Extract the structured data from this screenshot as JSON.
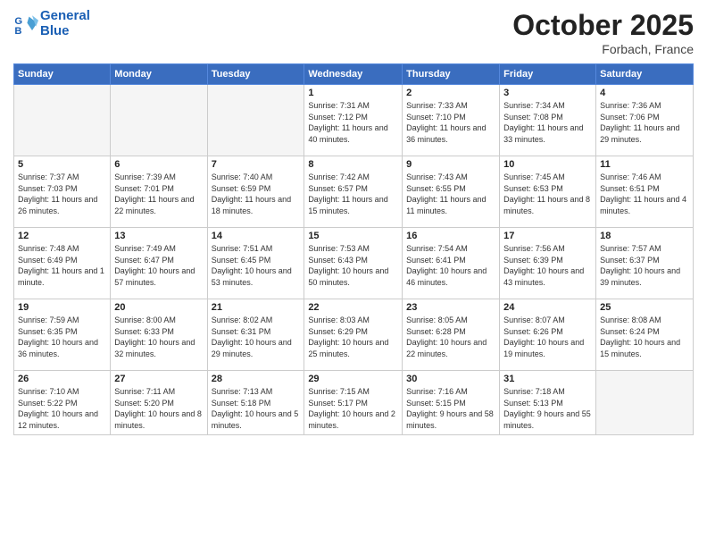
{
  "header": {
    "logo_line1": "General",
    "logo_line2": "Blue",
    "month": "October 2025",
    "location": "Forbach, France"
  },
  "weekdays": [
    "Sunday",
    "Monday",
    "Tuesday",
    "Wednesday",
    "Thursday",
    "Friday",
    "Saturday"
  ],
  "weeks": [
    [
      {
        "day": "",
        "info": ""
      },
      {
        "day": "",
        "info": ""
      },
      {
        "day": "",
        "info": ""
      },
      {
        "day": "1",
        "info": "Sunrise: 7:31 AM\nSunset: 7:12 PM\nDaylight: 11 hours\nand 40 minutes."
      },
      {
        "day": "2",
        "info": "Sunrise: 7:33 AM\nSunset: 7:10 PM\nDaylight: 11 hours\nand 36 minutes."
      },
      {
        "day": "3",
        "info": "Sunrise: 7:34 AM\nSunset: 7:08 PM\nDaylight: 11 hours\nand 33 minutes."
      },
      {
        "day": "4",
        "info": "Sunrise: 7:36 AM\nSunset: 7:06 PM\nDaylight: 11 hours\nand 29 minutes."
      }
    ],
    [
      {
        "day": "5",
        "info": "Sunrise: 7:37 AM\nSunset: 7:03 PM\nDaylight: 11 hours\nand 26 minutes."
      },
      {
        "day": "6",
        "info": "Sunrise: 7:39 AM\nSunset: 7:01 PM\nDaylight: 11 hours\nand 22 minutes."
      },
      {
        "day": "7",
        "info": "Sunrise: 7:40 AM\nSunset: 6:59 PM\nDaylight: 11 hours\nand 18 minutes."
      },
      {
        "day": "8",
        "info": "Sunrise: 7:42 AM\nSunset: 6:57 PM\nDaylight: 11 hours\nand 15 minutes."
      },
      {
        "day": "9",
        "info": "Sunrise: 7:43 AM\nSunset: 6:55 PM\nDaylight: 11 hours\nand 11 minutes."
      },
      {
        "day": "10",
        "info": "Sunrise: 7:45 AM\nSunset: 6:53 PM\nDaylight: 11 hours\nand 8 minutes."
      },
      {
        "day": "11",
        "info": "Sunrise: 7:46 AM\nSunset: 6:51 PM\nDaylight: 11 hours\nand 4 minutes."
      }
    ],
    [
      {
        "day": "12",
        "info": "Sunrise: 7:48 AM\nSunset: 6:49 PM\nDaylight: 11 hours\nand 1 minute."
      },
      {
        "day": "13",
        "info": "Sunrise: 7:49 AM\nSunset: 6:47 PM\nDaylight: 10 hours\nand 57 minutes."
      },
      {
        "day": "14",
        "info": "Sunrise: 7:51 AM\nSunset: 6:45 PM\nDaylight: 10 hours\nand 53 minutes."
      },
      {
        "day": "15",
        "info": "Sunrise: 7:53 AM\nSunset: 6:43 PM\nDaylight: 10 hours\nand 50 minutes."
      },
      {
        "day": "16",
        "info": "Sunrise: 7:54 AM\nSunset: 6:41 PM\nDaylight: 10 hours\nand 46 minutes."
      },
      {
        "day": "17",
        "info": "Sunrise: 7:56 AM\nSunset: 6:39 PM\nDaylight: 10 hours\nand 43 minutes."
      },
      {
        "day": "18",
        "info": "Sunrise: 7:57 AM\nSunset: 6:37 PM\nDaylight: 10 hours\nand 39 minutes."
      }
    ],
    [
      {
        "day": "19",
        "info": "Sunrise: 7:59 AM\nSunset: 6:35 PM\nDaylight: 10 hours\nand 36 minutes."
      },
      {
        "day": "20",
        "info": "Sunrise: 8:00 AM\nSunset: 6:33 PM\nDaylight: 10 hours\nand 32 minutes."
      },
      {
        "day": "21",
        "info": "Sunrise: 8:02 AM\nSunset: 6:31 PM\nDaylight: 10 hours\nand 29 minutes."
      },
      {
        "day": "22",
        "info": "Sunrise: 8:03 AM\nSunset: 6:29 PM\nDaylight: 10 hours\nand 25 minutes."
      },
      {
        "day": "23",
        "info": "Sunrise: 8:05 AM\nSunset: 6:28 PM\nDaylight: 10 hours\nand 22 minutes."
      },
      {
        "day": "24",
        "info": "Sunrise: 8:07 AM\nSunset: 6:26 PM\nDaylight: 10 hours\nand 19 minutes."
      },
      {
        "day": "25",
        "info": "Sunrise: 8:08 AM\nSunset: 6:24 PM\nDaylight: 10 hours\nand 15 minutes."
      }
    ],
    [
      {
        "day": "26",
        "info": "Sunrise: 7:10 AM\nSunset: 5:22 PM\nDaylight: 10 hours\nand 12 minutes."
      },
      {
        "day": "27",
        "info": "Sunrise: 7:11 AM\nSunset: 5:20 PM\nDaylight: 10 hours\nand 8 minutes."
      },
      {
        "day": "28",
        "info": "Sunrise: 7:13 AM\nSunset: 5:18 PM\nDaylight: 10 hours\nand 5 minutes."
      },
      {
        "day": "29",
        "info": "Sunrise: 7:15 AM\nSunset: 5:17 PM\nDaylight: 10 hours\nand 2 minutes."
      },
      {
        "day": "30",
        "info": "Sunrise: 7:16 AM\nSunset: 5:15 PM\nDaylight: 9 hours\nand 58 minutes."
      },
      {
        "day": "31",
        "info": "Sunrise: 7:18 AM\nSunset: 5:13 PM\nDaylight: 9 hours\nand 55 minutes."
      },
      {
        "day": "",
        "info": ""
      }
    ]
  ]
}
